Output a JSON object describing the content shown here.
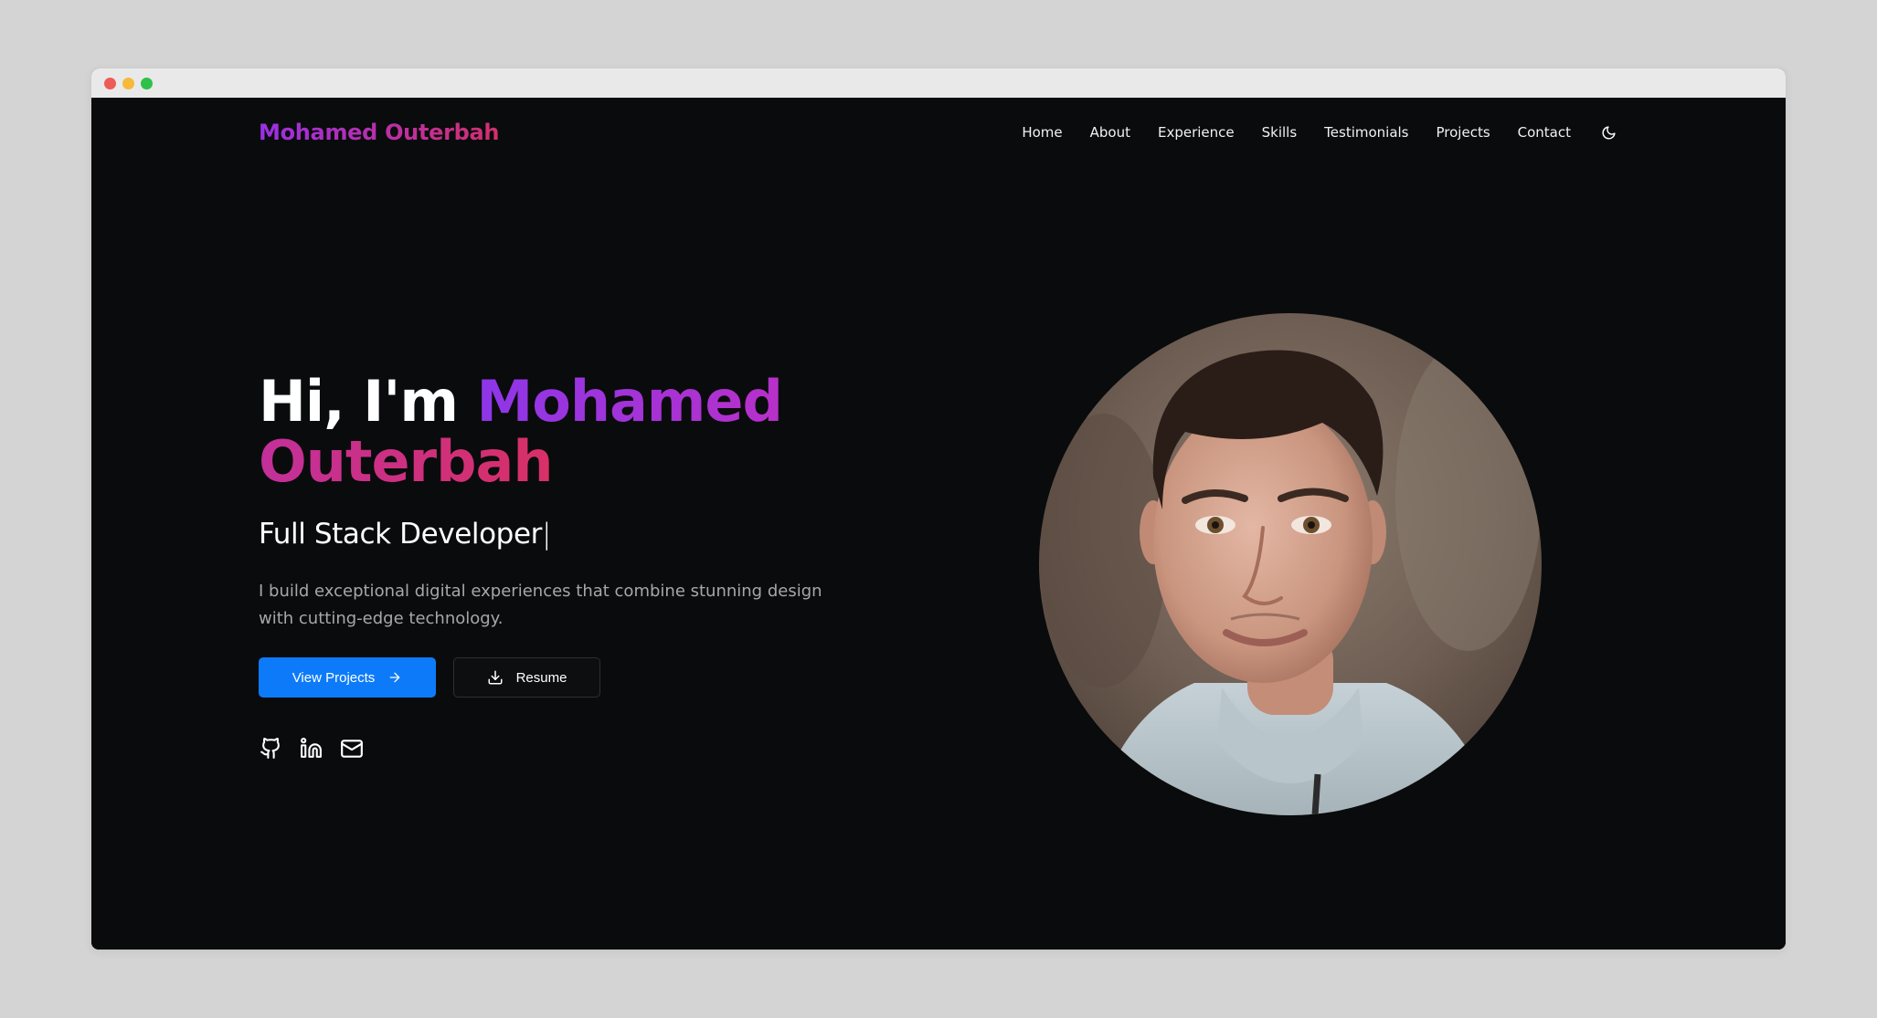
{
  "window": {
    "controls": [
      "close",
      "minimize",
      "maximize"
    ]
  },
  "navbar": {
    "brand": "Mohamed Outerbah",
    "links": [
      "Home",
      "About",
      "Experience",
      "Skills",
      "Testimonials",
      "Projects",
      "Contact"
    ],
    "theme_icon": "moon-icon"
  },
  "hero": {
    "greeting": "Hi, I'm",
    "name_first": "Mohamed",
    "name_last": "Outerbah",
    "role": "Full Stack Developer",
    "cursor": "|",
    "intro": "I build exceptional digital experiences that combine stunning design with cutting-edge technology.",
    "primary_button": "View Projects",
    "secondary_button": "Resume",
    "social_icons": [
      "github-icon",
      "linkedin-icon",
      "mail-icon"
    ]
  },
  "colors": {
    "background": "#0a0b0c",
    "accent_blue": "#0d7bf9",
    "gradient_start": "#8d36e8",
    "gradient_end": "#d83066"
  }
}
